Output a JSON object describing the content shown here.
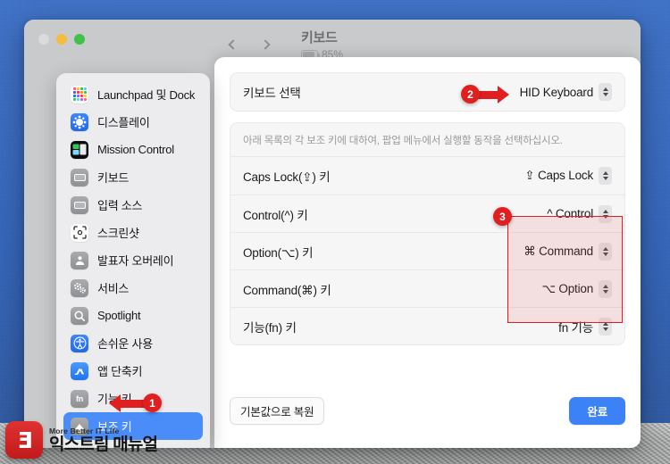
{
  "window": {
    "traffic_lights": [
      "close",
      "minimize",
      "zoom"
    ],
    "nav_back_icon": "chevron-left-icon",
    "nav_forward_icon": "chevron-right-icon",
    "title": "키보드",
    "battery_percent": "85%",
    "battery_level": 85
  },
  "sidebar": {
    "items": [
      {
        "label": "Launchpad 및 Dock",
        "icon": "launchpad-dock-icon",
        "selected": false
      },
      {
        "label": "디스플레이",
        "icon": "display-icon",
        "selected": false
      },
      {
        "label": "Mission Control",
        "icon": "mission-control-icon",
        "selected": false
      },
      {
        "label": "키보드",
        "icon": "keyboard-icon",
        "selected": false
      },
      {
        "label": "입력 소스",
        "icon": "input-sources-icon",
        "selected": false
      },
      {
        "label": "스크린샷",
        "icon": "screenshot-icon",
        "selected": false
      },
      {
        "label": "발표자 오버레이",
        "icon": "presenter-overlay-icon",
        "selected": false
      },
      {
        "label": "서비스",
        "icon": "services-gears-icon",
        "selected": false
      },
      {
        "label": "Spotlight",
        "icon": "spotlight-search-icon",
        "selected": false
      },
      {
        "label": "손쉬운 사용",
        "icon": "accessibility-icon",
        "selected": false
      },
      {
        "label": "앱 단축키",
        "icon": "app-shortcuts-icon",
        "selected": false
      },
      {
        "label": "기능 키",
        "icon": "function-keys-fn-icon",
        "selected": false
      },
      {
        "label": "보조 키",
        "icon": "modifier-keys-shift-icon",
        "selected": true
      }
    ]
  },
  "sheet": {
    "keyboard_select": {
      "label": "키보드 선택",
      "value": "HID Keyboard",
      "stepper_icon": "up-down-stepper-icon"
    },
    "hint": "아래 목록의 각 보조 키에 대하여, 팝업 메뉴에서 실행할 동작을 선택하십시오.",
    "modifier_rows": [
      {
        "label": "Caps Lock(⇪) 키",
        "value": "⇪ Caps Lock",
        "highlighted": false
      },
      {
        "label": "Control(^) 키",
        "value": "^ Control",
        "highlighted": false
      },
      {
        "label": "Option(⌥) 키",
        "value": "⌘ Command",
        "highlighted": true
      },
      {
        "label": "Command(⌘) 키",
        "value": "⌥ Option",
        "highlighted": true
      },
      {
        "label": "기능(fn) 키",
        "value": "fn 기능",
        "highlighted": true
      }
    ],
    "footer": {
      "restore_defaults_label": "기본값으로 복원",
      "done_label": "완료"
    }
  },
  "annotations": {
    "badge_1": "1",
    "badge_2": "2",
    "badge_3": "3",
    "accent_color": "#e02020",
    "highlight_fill": "rgba(233,72,72,0.13)"
  },
  "watermark": {
    "logo_text": "Ǝ",
    "tagline": "More Better IT Life",
    "name": "익스트림 매뉴얼",
    "logo_color": "#c81e1e"
  }
}
